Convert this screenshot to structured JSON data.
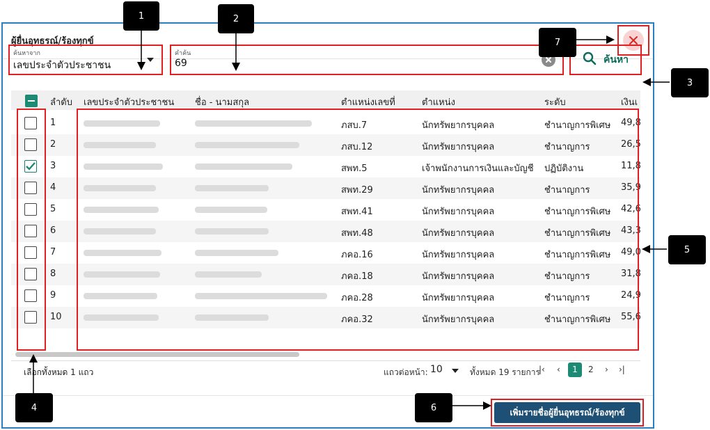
{
  "dialog": {
    "title": "ผู้ยื่นอุทธรณ์/ร้องทุกข์"
  },
  "search": {
    "field_label": "ค้นหาจาก",
    "field_value": "เลขประจำตัวประชาชน",
    "keyword_label": "คำค้น",
    "keyword_value": "69",
    "button_label": "ค้นหา"
  },
  "table": {
    "columns": [
      "ลำดับ",
      "เลขประจำตัวประชาชน",
      "ชื่อ - นามสกุล",
      "ตำแหน่งเลขที่",
      "ตำแหน่ง",
      "ระดับ",
      "เงินเ"
    ],
    "rows": [
      {
        "no": "1",
        "pos_no": "ภสบ.7",
        "position": "นักทรัพยากรบุคคล",
        "level": "ชำนาญการพิเศษ",
        "salary": "49,8",
        "checked": false
      },
      {
        "no": "2",
        "pos_no": "ภสบ.12",
        "position": "นักทรัพยากรบุคคล",
        "level": "ชำนาญการ",
        "salary": "26,5",
        "checked": false
      },
      {
        "no": "3",
        "pos_no": "สพท.5",
        "position": "เจ้าพนักงานการเงินและบัญชี",
        "level": "ปฏิบัติงาน",
        "salary": "11,8",
        "checked": true
      },
      {
        "no": "4",
        "pos_no": "สพท.29",
        "position": "นักทรัพยากรบุคคล",
        "level": "ชำนาญการ",
        "salary": "35,9",
        "checked": false
      },
      {
        "no": "5",
        "pos_no": "สพท.41",
        "position": "นักทรัพยากรบุคคล",
        "level": "ชำนาญการพิเศษ",
        "salary": "42,6",
        "checked": false
      },
      {
        "no": "6",
        "pos_no": "สพท.48",
        "position": "นักทรัพยากรบุคคล",
        "level": "ชำนาญการพิเศษ",
        "salary": "43,3",
        "checked": false
      },
      {
        "no": "7",
        "pos_no": "ภคอ.16",
        "position": "นักทรัพยากรบุคคล",
        "level": "ชำนาญการพิเศษ",
        "salary": "49,0",
        "checked": false
      },
      {
        "no": "8",
        "pos_no": "ภคอ.18",
        "position": "นักทรัพยากรบุคคล",
        "level": "ชำนาญการ",
        "salary": "31,8",
        "checked": false
      },
      {
        "no": "9",
        "pos_no": "ภคอ.28",
        "position": "นักทรัพยากรบุคคล",
        "level": "ชำนาญการ",
        "salary": "24,9",
        "checked": false
      },
      {
        "no": "10",
        "pos_no": "ภคอ.32",
        "position": "นักทรัพยากรบุคคล",
        "level": "ชำนาญการพิเศษ",
        "salary": "55,6",
        "checked": false
      }
    ]
  },
  "footer": {
    "selected_text": "เลือกทั้งหมด 1 แถว",
    "rows_per_page_label": "แถวต่อหน้า:",
    "rows_per_page": "10",
    "total_text": "ทั้งหมด 19 รายการ",
    "pages": [
      "1",
      "2"
    ],
    "current_page": "1",
    "first_glyph": "|‹",
    "prev_glyph": "‹",
    "next_glyph": "›",
    "last_glyph": "›|"
  },
  "actions": {
    "add_label": "เพิ่มรายชื่อผู้ยื่นอุทธรณ์/ร้องทุกข์"
  },
  "callouts": [
    "1",
    "2",
    "3",
    "4",
    "5",
    "6",
    "7"
  ],
  "colors": {
    "accent": "#1d8a74",
    "primary_button": "#1e4f74",
    "highlight": "#e02020",
    "dialog_border": "#2a7fc1"
  }
}
